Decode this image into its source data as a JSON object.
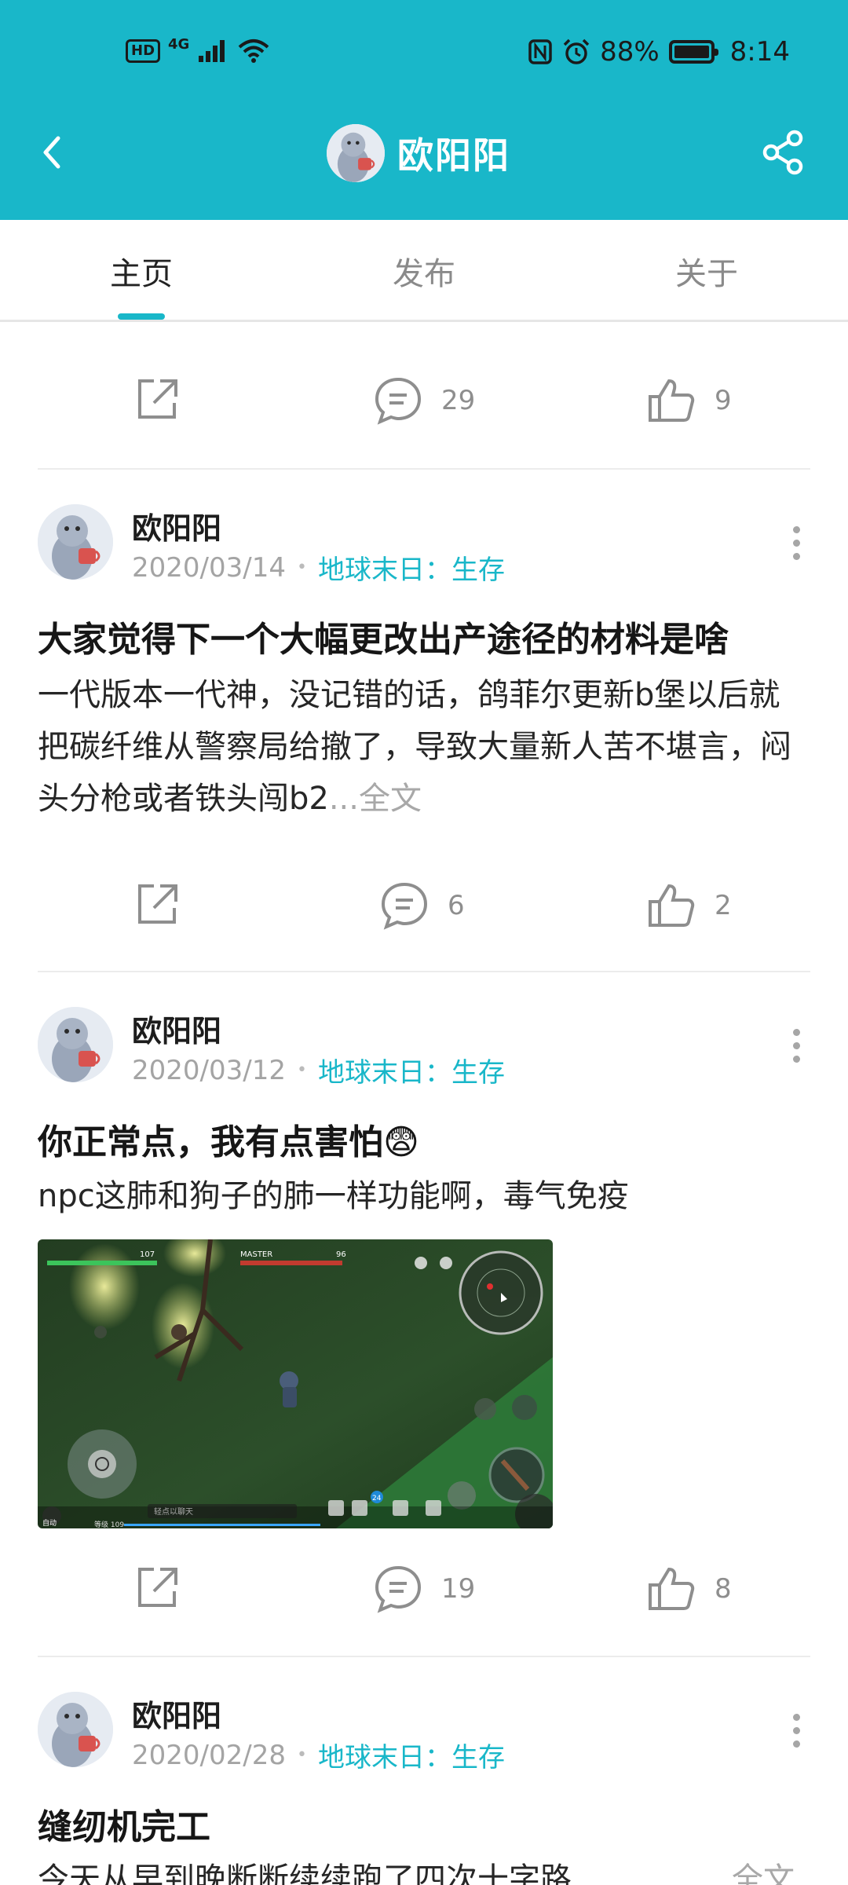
{
  "status_bar": {
    "hd": "HD",
    "network": "4G",
    "battery": "88%",
    "time": "8:14"
  },
  "header": {
    "title": "欧阳阳",
    "back_icon": "chevron-left-icon",
    "share_icon": "share-icon"
  },
  "tabs": [
    {
      "label": "主页",
      "active": true
    },
    {
      "label": "发布",
      "active": false
    },
    {
      "label": "关于",
      "active": false
    }
  ],
  "top_actions": {
    "comments": "29",
    "likes": "9"
  },
  "posts": [
    {
      "author": "欧阳阳",
      "date": "2020/03/14",
      "category_prefix": "地球末日：",
      "category": "生存",
      "title": "大家觉得下一个大幅更改出产途径的材料是啥",
      "body": "一代版本一代神，没记错的话，鸽菲尔更新b堡以后就把碳纤维从警察局给撤了，导致大量新人苦不堪言，闷头分枪或者铁头闯b2",
      "ellipsis": "...",
      "fulltext": "全文",
      "comments": "6",
      "likes": "2"
    },
    {
      "author": "欧阳阳",
      "date": "2020/03/12",
      "category_prefix": "地球末日：",
      "category": "生存",
      "title": "你正常点，我有点害怕😨",
      "body": "npc这肺和狗子的肺一样功能啊，毒气免疫",
      "image_hud": {
        "player_name": "MASTER",
        "hp": "107",
        "enemy_hp": "96",
        "chat_placeholder": "轻点以聊天",
        "level": "等级 109",
        "auto": "自动",
        "badge": "24"
      },
      "comments": "19",
      "likes": "8"
    },
    {
      "author": "欧阳阳",
      "date": "2020/02/28",
      "category_prefix": "地球末日：",
      "category": "生存",
      "title": "缝纫机完工",
      "body": "今天从早到晚断断续续跑了四次十字路",
      "fulltext": "全文"
    }
  ],
  "colors": {
    "accent": "#19b7c9"
  }
}
